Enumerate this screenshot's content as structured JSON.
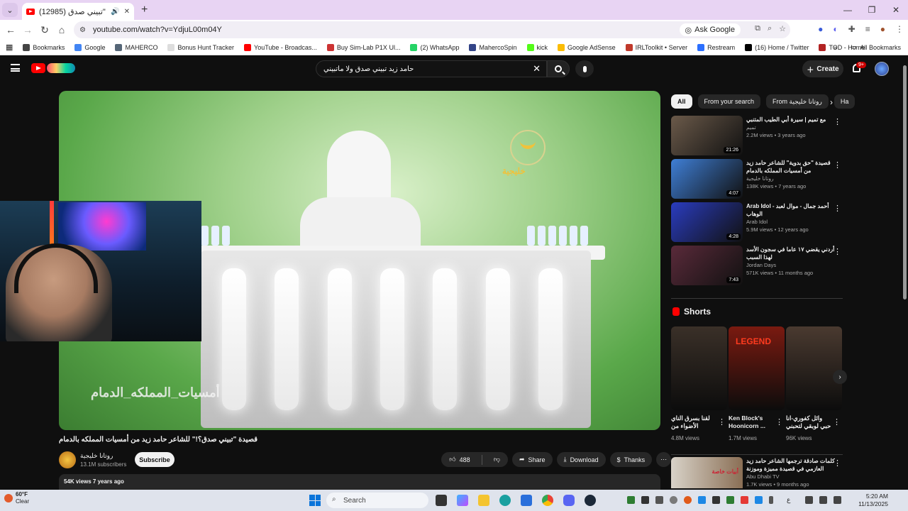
{
  "browser": {
    "tab_title": "قصيدة \"تبيني صدق (12985)",
    "url": "youtube.com/watch?v=YdjuL00m04Y",
    "ask_google": "Ask Google",
    "bookmarks": [
      {
        "label": "Bookmarks",
        "color": "#444444"
      },
      {
        "label": "Google",
        "color": "#4285f4"
      },
      {
        "label": "MAHERCO",
        "color": "#556677"
      },
      {
        "label": "Bonus Hunt Tracker",
        "color": "#dddddd"
      },
      {
        "label": "YouTube - Broadcas...",
        "color": "#ff0000"
      },
      {
        "label": "Buy Sim-Lab P1X Ul...",
        "color": "#cc3333"
      },
      {
        "label": "(2) WhatsApp",
        "color": "#25d366"
      },
      {
        "label": "MahercoSpin",
        "color": "#334488"
      },
      {
        "label": "kick",
        "color": "#53fc18"
      },
      {
        "label": "Google AdSense",
        "color": "#fbbc04"
      },
      {
        "label": "IRLToolkit • Server",
        "color": "#c0392b"
      },
      {
        "label": "Restream",
        "color": "#2b6fff"
      },
      {
        "label": "(16) Home / Twitter",
        "color": "#000000"
      },
      {
        "label": "TOD - Home",
        "color": "#b22222"
      }
    ],
    "all_bookmarks": "All Bookmarks"
  },
  "youtube": {
    "search_query": "حامد زيد تبيني صدق ولا ماتبيني",
    "create_label": "Create",
    "notif_count": "9+"
  },
  "video": {
    "overlay_text": "أمسيات_المملكه_الدمام",
    "channel_logo_text": "خليجية",
    "title": "قصيدة \"تبيني صدق؟!\" للشاعر حامد زيد من أمسيات المملكه بالدمام",
    "channel": "روتانا خليجية",
    "subscribers": "13.1M subscribers",
    "subscribe": "Subscribe",
    "likes": "488",
    "share": "Share",
    "download": "Download",
    "thanks": "Thanks",
    "desc_meta": "54K views  7 years ago"
  },
  "chips": [
    "All",
    "From your search",
    "From روتانا خليجية",
    "Ha"
  ],
  "recommendations": [
    {
      "title": "مع تميم | سيرة أبي الطيب المتنبي",
      "channel": "تميم",
      "meta": "2.2M views • 3 years ago",
      "duration": "21:26",
      "color": "#6b5a4a"
    },
    {
      "title": "قصيدة \"حق بدوية\" للشاعر حامد زيد من أمسيات المملكه بالدمام",
      "channel": "روتانا خليجية",
      "meta": "138K views • 7 years ago",
      "duration": "4:07",
      "color": "#3f7fd6"
    },
    {
      "title": "Arab Idol - أحمد جمال - موال لعبد الوهاب",
      "channel": "Arab Idol",
      "meta": "5.9M views • 12 years ago",
      "duration": "4:28",
      "color": "#2a3cbf"
    },
    {
      "title": "أردني يقضي ١٧ عاما في سجون الأسد لهذا السبب",
      "channel": "Jordan Days",
      "meta": "571K views • 11 months ago",
      "duration": "7:43",
      "color": "#5a2a3a"
    }
  ],
  "shorts_header": "Shorts",
  "shorts": [
    {
      "title": "لقنا بسرق الناي الأضواء من",
      "views": "4.8M views",
      "color": "#3a3028"
    },
    {
      "title": "Ken Block's Hoonicorn ...",
      "views": "1.7M views",
      "color": "#7a1a10",
      "badge": "LEGEND"
    },
    {
      "title": "وائل كفوري-انا حبي لوبقي لتحبني",
      "views": "96K views",
      "color": "#4a3a30"
    }
  ],
  "last_rec": {
    "title": "كلمات صادقة ترجمها الشاعر حامد زيد العازمي في قصيدة مميزة وموزنة وزن",
    "channel": "Abu Dhabi TV",
    "meta": "1.7K views • 9 months ago",
    "thumb_text": "أبيات خاصة"
  },
  "taskbar": {
    "temp": "60°F",
    "weather": "Clear",
    "search": "Search",
    "time": "5:20 AM",
    "date": "11/13/2025",
    "lang": "ع"
  }
}
